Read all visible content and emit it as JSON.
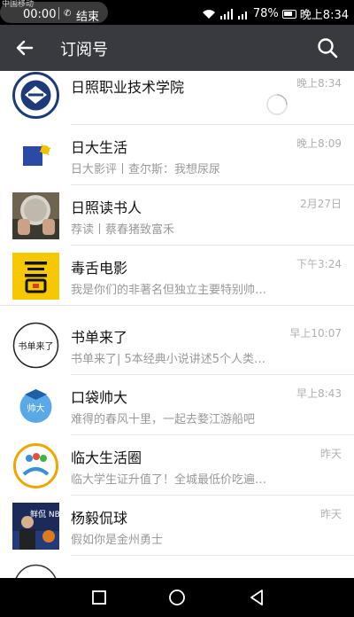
{
  "statusbar": {
    "carrier": "中国移动",
    "call_time": "00:00",
    "call_end": "结束",
    "battery": "78%",
    "clock": "晚上8:34"
  },
  "appbar": {
    "title": "订阅号"
  },
  "items": [
    {
      "name": "日照职业技术学院",
      "subtitle": "",
      "time": "晚上8:34"
    },
    {
      "name": "日大生活",
      "subtitle": "日大影评丨查尔斯：我想尿尿",
      "time": "晚上8:09"
    },
    {
      "name": "日照读书人",
      "subtitle": "荐读丨蔡春猪致富禾",
      "time": "2月27日"
    },
    {
      "name": "毒舌电影",
      "subtitle": "我是你们的非著名但独立主要特别帅…",
      "time": "下午3:24"
    },
    {
      "name": "书单来了",
      "subtitle": "书单来了| 5本经典小说讲述5个人类…",
      "time": "早上10:07"
    },
    {
      "name": "口袋帅大",
      "subtitle": "难得的春风十里，一起去婺江游船吧",
      "time": "早上8:43"
    },
    {
      "name": "临大生活圈",
      "subtitle": "临大学生证升值了！全城最低价吃遍…",
      "time": "昨天"
    },
    {
      "name": "杨毅侃球",
      "subtitle": "假如你是金州勇士",
      "time": "昨天"
    }
  ],
  "avatar_text": {
    "shudan": "书单来了",
    "koudai": "帅大",
    "yangyi": "鲜侃 NBA"
  }
}
